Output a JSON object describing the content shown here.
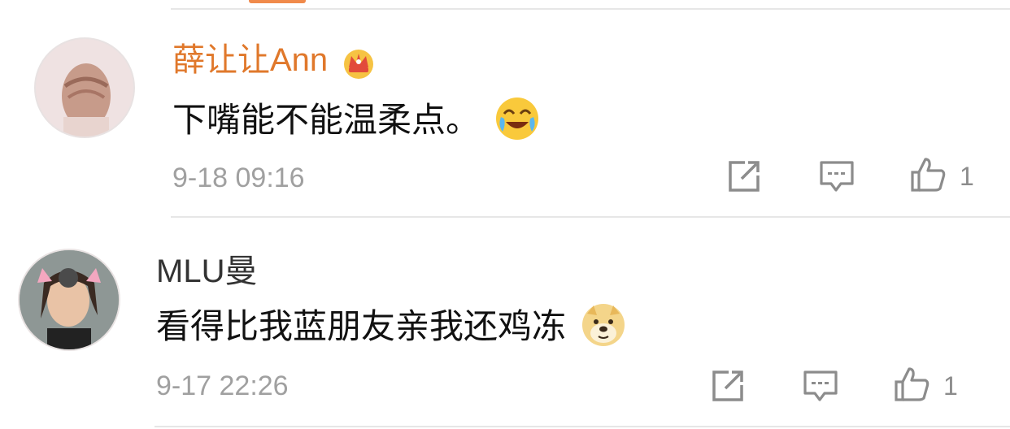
{
  "comments": [
    {
      "username": "薛让让Ann",
      "username_color": "#e0782b",
      "badge_icon": "crown-icon",
      "text": "下嘴能不能温柔点。",
      "emoji_icon": "laugh-cry-emoji",
      "time": "9-18 09:16",
      "actions": {
        "share_icon": "share-icon",
        "reply_icon": "comment-icon",
        "like_icon": "thumb-up-icon"
      },
      "like_count": "1"
    },
    {
      "username": "MLU曼",
      "username_color": "#333333",
      "text": "看得比我蓝朋友亲我还鸡冻",
      "emoji_icon": "doge-emoji",
      "time": "9-17 22:26",
      "actions": {
        "share_icon": "share-icon",
        "reply_icon": "comment-icon",
        "like_icon": "thumb-up-icon"
      },
      "like_count": "1"
    }
  ]
}
